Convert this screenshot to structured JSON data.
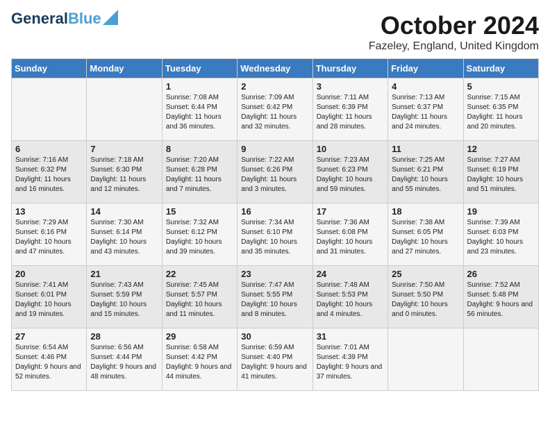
{
  "header": {
    "logo_line1": "General",
    "logo_line2": "Blue",
    "month": "October 2024",
    "location": "Fazeley, England, United Kingdom"
  },
  "days_of_week": [
    "Sunday",
    "Monday",
    "Tuesday",
    "Wednesday",
    "Thursday",
    "Friday",
    "Saturday"
  ],
  "weeks": [
    [
      {
        "day": "",
        "sunrise": "",
        "sunset": "",
        "daylight": ""
      },
      {
        "day": "",
        "sunrise": "",
        "sunset": "",
        "daylight": ""
      },
      {
        "day": "1",
        "sunrise": "Sunrise: 7:08 AM",
        "sunset": "Sunset: 6:44 PM",
        "daylight": "Daylight: 11 hours and 36 minutes."
      },
      {
        "day": "2",
        "sunrise": "Sunrise: 7:09 AM",
        "sunset": "Sunset: 6:42 PM",
        "daylight": "Daylight: 11 hours and 32 minutes."
      },
      {
        "day": "3",
        "sunrise": "Sunrise: 7:11 AM",
        "sunset": "Sunset: 6:39 PM",
        "daylight": "Daylight: 11 hours and 28 minutes."
      },
      {
        "day": "4",
        "sunrise": "Sunrise: 7:13 AM",
        "sunset": "Sunset: 6:37 PM",
        "daylight": "Daylight: 11 hours and 24 minutes."
      },
      {
        "day": "5",
        "sunrise": "Sunrise: 7:15 AM",
        "sunset": "Sunset: 6:35 PM",
        "daylight": "Daylight: 11 hours and 20 minutes."
      }
    ],
    [
      {
        "day": "6",
        "sunrise": "Sunrise: 7:16 AM",
        "sunset": "Sunset: 6:32 PM",
        "daylight": "Daylight: 11 hours and 16 minutes."
      },
      {
        "day": "7",
        "sunrise": "Sunrise: 7:18 AM",
        "sunset": "Sunset: 6:30 PM",
        "daylight": "Daylight: 11 hours and 12 minutes."
      },
      {
        "day": "8",
        "sunrise": "Sunrise: 7:20 AM",
        "sunset": "Sunset: 6:28 PM",
        "daylight": "Daylight: 11 hours and 7 minutes."
      },
      {
        "day": "9",
        "sunrise": "Sunrise: 7:22 AM",
        "sunset": "Sunset: 6:26 PM",
        "daylight": "Daylight: 11 hours and 3 minutes."
      },
      {
        "day": "10",
        "sunrise": "Sunrise: 7:23 AM",
        "sunset": "Sunset: 6:23 PM",
        "daylight": "Daylight: 10 hours and 59 minutes."
      },
      {
        "day": "11",
        "sunrise": "Sunrise: 7:25 AM",
        "sunset": "Sunset: 6:21 PM",
        "daylight": "Daylight: 10 hours and 55 minutes."
      },
      {
        "day": "12",
        "sunrise": "Sunrise: 7:27 AM",
        "sunset": "Sunset: 6:19 PM",
        "daylight": "Daylight: 10 hours and 51 minutes."
      }
    ],
    [
      {
        "day": "13",
        "sunrise": "Sunrise: 7:29 AM",
        "sunset": "Sunset: 6:16 PM",
        "daylight": "Daylight: 10 hours and 47 minutes."
      },
      {
        "day": "14",
        "sunrise": "Sunrise: 7:30 AM",
        "sunset": "Sunset: 6:14 PM",
        "daylight": "Daylight: 10 hours and 43 minutes."
      },
      {
        "day": "15",
        "sunrise": "Sunrise: 7:32 AM",
        "sunset": "Sunset: 6:12 PM",
        "daylight": "Daylight: 10 hours and 39 minutes."
      },
      {
        "day": "16",
        "sunrise": "Sunrise: 7:34 AM",
        "sunset": "Sunset: 6:10 PM",
        "daylight": "Daylight: 10 hours and 35 minutes."
      },
      {
        "day": "17",
        "sunrise": "Sunrise: 7:36 AM",
        "sunset": "Sunset: 6:08 PM",
        "daylight": "Daylight: 10 hours and 31 minutes."
      },
      {
        "day": "18",
        "sunrise": "Sunrise: 7:38 AM",
        "sunset": "Sunset: 6:05 PM",
        "daylight": "Daylight: 10 hours and 27 minutes."
      },
      {
        "day": "19",
        "sunrise": "Sunrise: 7:39 AM",
        "sunset": "Sunset: 6:03 PM",
        "daylight": "Daylight: 10 hours and 23 minutes."
      }
    ],
    [
      {
        "day": "20",
        "sunrise": "Sunrise: 7:41 AM",
        "sunset": "Sunset: 6:01 PM",
        "daylight": "Daylight: 10 hours and 19 minutes."
      },
      {
        "day": "21",
        "sunrise": "Sunrise: 7:43 AM",
        "sunset": "Sunset: 5:59 PM",
        "daylight": "Daylight: 10 hours and 15 minutes."
      },
      {
        "day": "22",
        "sunrise": "Sunrise: 7:45 AM",
        "sunset": "Sunset: 5:57 PM",
        "daylight": "Daylight: 10 hours and 11 minutes."
      },
      {
        "day": "23",
        "sunrise": "Sunrise: 7:47 AM",
        "sunset": "Sunset: 5:55 PM",
        "daylight": "Daylight: 10 hours and 8 minutes."
      },
      {
        "day": "24",
        "sunrise": "Sunrise: 7:48 AM",
        "sunset": "Sunset: 5:53 PM",
        "daylight": "Daylight: 10 hours and 4 minutes."
      },
      {
        "day": "25",
        "sunrise": "Sunrise: 7:50 AM",
        "sunset": "Sunset: 5:50 PM",
        "daylight": "Daylight: 10 hours and 0 minutes."
      },
      {
        "day": "26",
        "sunrise": "Sunrise: 7:52 AM",
        "sunset": "Sunset: 5:48 PM",
        "daylight": "Daylight: 9 hours and 56 minutes."
      }
    ],
    [
      {
        "day": "27",
        "sunrise": "Sunrise: 6:54 AM",
        "sunset": "Sunset: 4:46 PM",
        "daylight": "Daylight: 9 hours and 52 minutes."
      },
      {
        "day": "28",
        "sunrise": "Sunrise: 6:56 AM",
        "sunset": "Sunset: 4:44 PM",
        "daylight": "Daylight: 9 hours and 48 minutes."
      },
      {
        "day": "29",
        "sunrise": "Sunrise: 6:58 AM",
        "sunset": "Sunset: 4:42 PM",
        "daylight": "Daylight: 9 hours and 44 minutes."
      },
      {
        "day": "30",
        "sunrise": "Sunrise: 6:59 AM",
        "sunset": "Sunset: 4:40 PM",
        "daylight": "Daylight: 9 hours and 41 minutes."
      },
      {
        "day": "31",
        "sunrise": "Sunrise: 7:01 AM",
        "sunset": "Sunset: 4:39 PM",
        "daylight": "Daylight: 9 hours and 37 minutes."
      },
      {
        "day": "",
        "sunrise": "",
        "sunset": "",
        "daylight": ""
      },
      {
        "day": "",
        "sunrise": "",
        "sunset": "",
        "daylight": ""
      }
    ]
  ]
}
